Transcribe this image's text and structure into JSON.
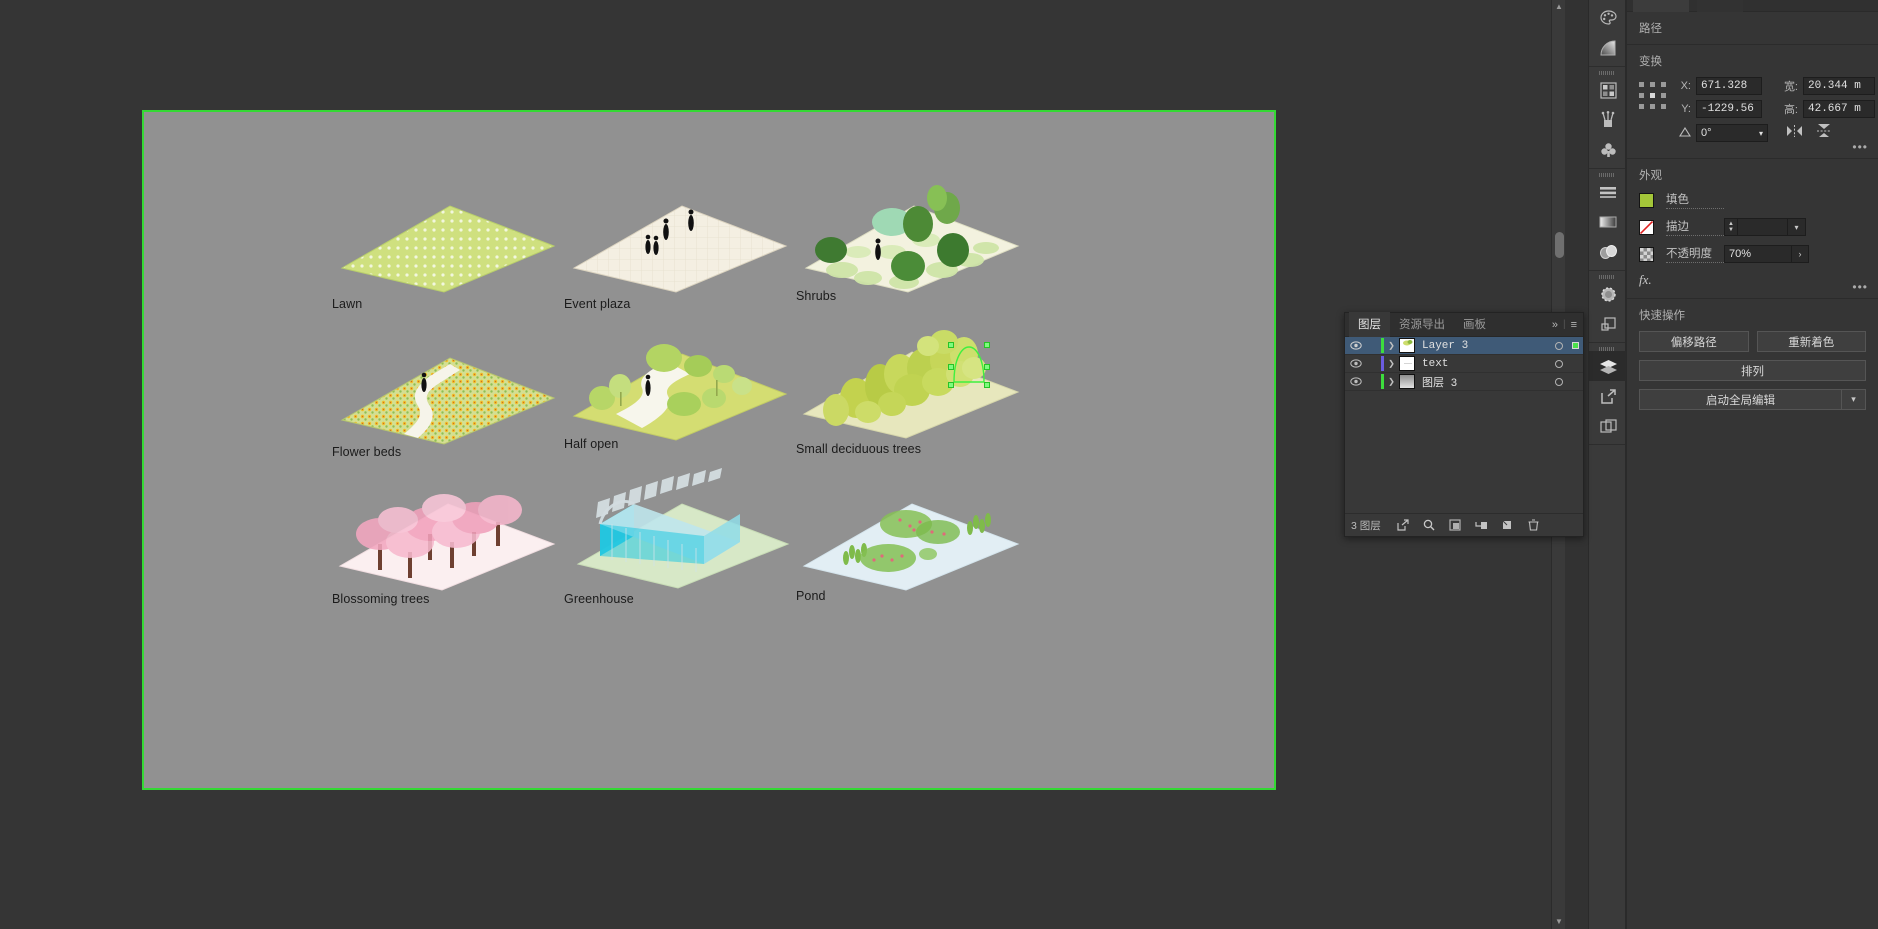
{
  "canvas": {
    "artboard_bg": "#919191",
    "artboard_border": "#34d934",
    "tiles": [
      {
        "label": "Lawn",
        "kind": "lawn"
      },
      {
        "label": "Event plaza",
        "kind": "plaza"
      },
      {
        "label": "Shrubs",
        "kind": "shrubs"
      },
      {
        "label": "Flower beds",
        "kind": "flowers"
      },
      {
        "label": "Half open",
        "kind": "halfopen"
      },
      {
        "label": "Small deciduous trees",
        "kind": "deciduous"
      },
      {
        "label": "Blossoming trees",
        "kind": "blossom"
      },
      {
        "label": "Greenhouse",
        "kind": "greenhouse"
      },
      {
        "label": "Pond",
        "kind": "pond"
      }
    ]
  },
  "icon_dock": {
    "items": [
      {
        "name": "color-palette-icon",
        "active": false
      },
      {
        "name": "gradient-icon",
        "active": false
      },
      {
        "name": "swatches-icon",
        "active": false
      },
      {
        "name": "brushes-icon",
        "active": false
      },
      {
        "name": "symbols-icon",
        "active": false
      },
      {
        "name": "align-icon",
        "active": false
      },
      {
        "name": "gradient-panel-icon",
        "active": false
      },
      {
        "name": "appearance-icon",
        "active": false
      },
      {
        "name": "transparency-icon",
        "active": false
      },
      {
        "name": "pathfinder-icon",
        "active": false
      },
      {
        "name": "layers-icon",
        "active": true
      },
      {
        "name": "asset-export-icon",
        "active": false
      },
      {
        "name": "artboards-icon",
        "active": false
      }
    ]
  },
  "layers_panel": {
    "tabs": [
      {
        "label": "图层",
        "active": true
      },
      {
        "label": "资源导出",
        "active": false
      },
      {
        "label": "画板",
        "active": false
      }
    ],
    "collapse_icon": "»",
    "menu_icon": "≡",
    "rows": [
      {
        "name": "Layer 3",
        "color": "#3ddc3d",
        "selected": true,
        "visible": true,
        "has_selection_mark": true
      },
      {
        "name": "text",
        "color": "#6b5ce0",
        "selected": false,
        "visible": true,
        "has_selection_mark": false
      },
      {
        "name": "图层 3",
        "color": "#3ddc3d",
        "selected": false,
        "visible": true,
        "has_selection_mark": false
      }
    ],
    "footer_count": "3 图层",
    "footer_icons": [
      "export-icon",
      "locate-object-icon",
      "make-mask-icon",
      "create-sublayer-icon",
      "new-layer-icon",
      "delete-layer-icon"
    ]
  },
  "properties": {
    "path_section_title": "路径",
    "transform": {
      "title": "变换",
      "x_label": "X:",
      "x_value": "671.328",
      "y_label": "Y:",
      "y_value": "-1229.56",
      "w_label": "宽:",
      "w_value": "20.344 m",
      "h_label": "高:",
      "h_value": "42.667 m",
      "angle_value": "0°",
      "link_icon": "broken-link-icon",
      "flip_h_icon": "flip-horizontal-icon",
      "flip_v_icon": "flip-vertical-icon",
      "more_icon": "•••"
    },
    "appearance": {
      "title": "外观",
      "fill_label": "填色",
      "fill_color": "#a4c639",
      "stroke_label": "描边",
      "stroke_value": "",
      "stroke_none": true,
      "opacity_label": "不透明度",
      "opacity_value": "70%",
      "fx_label": "fx."
    },
    "quick_actions": {
      "title": "快速操作",
      "offset_path": "偏移路径",
      "recolor": "重新着色",
      "arrange": "排列",
      "global_edit": "启动全局编辑",
      "more_icon": "•••"
    }
  }
}
